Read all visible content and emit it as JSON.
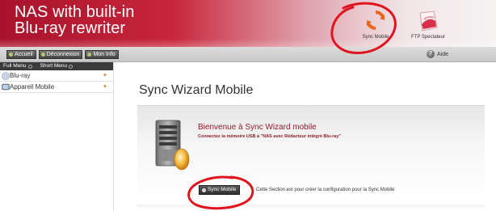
{
  "header": {
    "title_line1": "NAS with built-in",
    "title_line2": "Blu-ray rewriter",
    "apps": [
      {
        "label": "Sync Mobile",
        "icon": "sync-icon"
      },
      {
        "label": "FTP Spectateur",
        "icon": "ftp-icon"
      }
    ]
  },
  "nav": {
    "buttons": [
      "Accueil",
      "Déconnexion",
      "Mon Info"
    ],
    "help": "Aide"
  },
  "sidebar": {
    "tabs": [
      "Full Menu",
      "Short Menu"
    ],
    "items": [
      {
        "label": "Blu-ray",
        "icon": "blu-ray-icon"
      },
      {
        "label": "Appareil Mobile",
        "icon": "mobile-device-icon"
      }
    ]
  },
  "main": {
    "title": "Sync Wizard Mobile",
    "welcome": "Bienvenue à Sync Wizard mobile",
    "subtitle": "Connectez la mémoire USB à \"NAS avec Rédacteur intégré Blu-ray\"",
    "button": "Sync Mobile",
    "description": "Cette Section est pour créer la configuration pour la Sync Mobile"
  },
  "colors": {
    "header_red": "#c8263c",
    "accent_orange": "#e37a2a",
    "welcome_text": "#8d1d28",
    "annotation_red": "#e0141e"
  }
}
